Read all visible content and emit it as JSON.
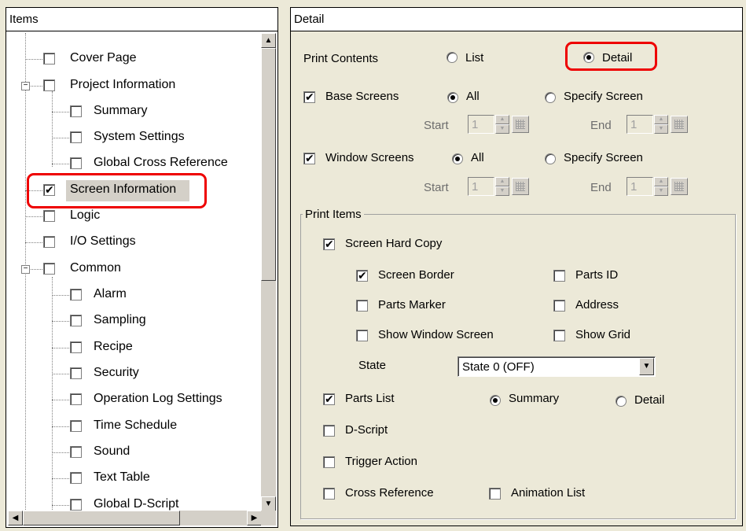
{
  "left": {
    "header": "Items",
    "tree": [
      {
        "label": "Cover Page",
        "checked": false
      },
      {
        "label": "Project Information",
        "checked": false
      },
      {
        "label": "Summary",
        "checked": false
      },
      {
        "label": "System Settings",
        "checked": false
      },
      {
        "label": "Global Cross Reference",
        "checked": false
      },
      {
        "label": "Screen Information",
        "checked": true
      },
      {
        "label": "Logic",
        "checked": false
      },
      {
        "label": "I/O Settings",
        "checked": false
      },
      {
        "label": "Common",
        "checked": false
      },
      {
        "label": "Alarm",
        "checked": false
      },
      {
        "label": "Sampling",
        "checked": false
      },
      {
        "label": "Recipe",
        "checked": false
      },
      {
        "label": "Security",
        "checked": false
      },
      {
        "label": "Operation Log Settings",
        "checked": false
      },
      {
        "label": "Time Schedule",
        "checked": false
      },
      {
        "label": "Sound",
        "checked": false
      },
      {
        "label": "Text Table",
        "checked": false
      },
      {
        "label": "Global D-Script",
        "checked": false
      }
    ]
  },
  "right": {
    "header": "Detail",
    "print_contents": {
      "label": "Print Contents",
      "list": "List",
      "detail": "Detail",
      "selected": "Detail"
    },
    "base_screens": {
      "label": "Base Screens",
      "checked": true,
      "all": "All",
      "specify": "Specify Screen",
      "start_label": "Start",
      "start": "1",
      "end_label": "End",
      "end": "1"
    },
    "window_screens": {
      "label": "Window Screens",
      "checked": true,
      "all": "All",
      "specify": "Specify Screen",
      "start_label": "Start",
      "start": "1",
      "end_label": "End",
      "end": "1"
    },
    "print_items": {
      "title": "Print Items",
      "screen_hard_copy": "Screen Hard Copy",
      "screen_border": "Screen Border",
      "parts_id": "Parts ID",
      "parts_marker": "Parts Marker",
      "address": "Address",
      "show_window_screen": "Show Window Screen",
      "show_grid": "Show Grid",
      "state_label": "State",
      "state_value": "State 0 (OFF)",
      "parts_list": "Parts List",
      "summary": "Summary",
      "detail": "Detail",
      "d_script": "D-Script",
      "trigger_action": "Trigger Action",
      "cross_reference": "Cross Reference",
      "animation_list": "Animation List"
    }
  }
}
